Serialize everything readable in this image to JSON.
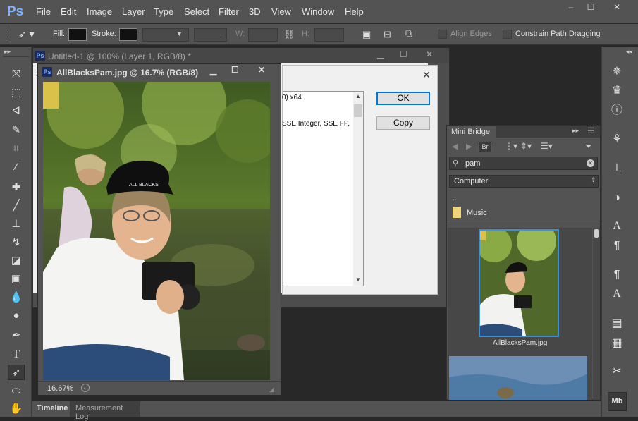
{
  "app": {
    "logo": "Ps",
    "menu": [
      "File",
      "Edit",
      "Image",
      "Layer",
      "Type",
      "Select",
      "Filter",
      "3D",
      "View",
      "Window",
      "Help"
    ],
    "window_controls": [
      "–",
      "☐",
      "✕"
    ]
  },
  "options_bar": {
    "fill_label": "Fill:",
    "stroke_label": "Stroke:",
    "w_label": "W:",
    "h_label": "H:",
    "align_edges": "Align Edges",
    "constrain_path": "Constrain Path Dragging"
  },
  "doc1": {
    "title": "Untitled-1 @ 100% (Layer 1, RGB/8) *",
    "left_fragment": "S"
  },
  "dialog": {
    "text_line1": "0) x64",
    "text_line2": "SSE Integer, SSE FP,",
    "ok_label": "OK",
    "copy_label": "Copy"
  },
  "doc2": {
    "title": "AllBlacksPam.jpg @ 16.7% (RGB/8)",
    "zoom": "16.67%",
    "cap_text": "ALL BLACKS"
  },
  "mini_bridge": {
    "tab": "Mini Bridge",
    "search_value": "pam",
    "location": "Computer",
    "parent_folder": "..",
    "folder_name": "Music",
    "thumb_label": "AllBlacksPam.jpg",
    "br_label": "Br"
  },
  "bottom_tabs": [
    "Timeline",
    "Measurement Log"
  ],
  "right_panel": {
    "mb_label": "Mb"
  },
  "colors": {
    "ps_blue": "#7fb3ff",
    "panel_gray": "#535353",
    "canvas_dark": "#282828",
    "selection_blue": "#3a8fd8"
  }
}
